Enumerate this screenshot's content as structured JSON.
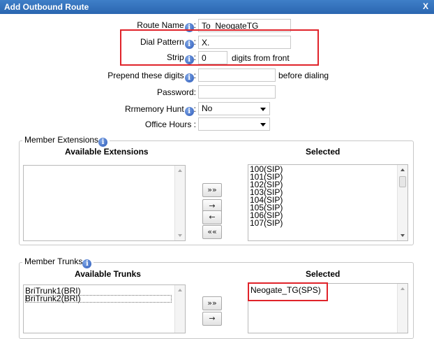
{
  "window": {
    "title": "Add Outbound Route",
    "close_label": "X"
  },
  "form": {
    "route_name": {
      "label": "Route Name",
      "value": "To_NeogateTG"
    },
    "dial_pattern": {
      "label": "Dial Pattern",
      "value": "X."
    },
    "strip": {
      "label": "Strip",
      "value": "0",
      "suffix": "digits from front"
    },
    "prepend": {
      "label": "Prepend these digits",
      "value": "",
      "suffix": "before dialing"
    },
    "password": {
      "label": "Password:",
      "value": ""
    },
    "rrmemory": {
      "label": "Rrmemory Hunt",
      "value": "No"
    },
    "office_hours": {
      "label": "Office Hours :",
      "value": ""
    },
    "separator": ":"
  },
  "extensions": {
    "legend": "Member Extensions",
    "available_header": "Available Extensions",
    "selected_header": "Selected",
    "available": [],
    "selected": [
      "100(SIP)",
      "101(SIP)",
      "102(SIP)",
      "103(SIP)",
      "104(SIP)",
      "105(SIP)",
      "106(SIP)",
      "107(SIP)"
    ],
    "buttons": {
      "add_all": "»»",
      "add": "→",
      "remove": "←",
      "remove_all": "««"
    }
  },
  "trunks": {
    "legend": "Member Trunks",
    "available_header": "Available Trunks",
    "selected_header": "Selected",
    "available": [
      "BriTrunk1(BRI)",
      "BriTrunk2(BRI)"
    ],
    "selected": [
      "Neogate_TG(SPS)"
    ],
    "buttons": {
      "add_all": "»»",
      "add": "→"
    }
  },
  "colors": {
    "title_bar": "#2f6fbf",
    "highlight": "#e0232a",
    "info_icon": "#2a58b8"
  }
}
